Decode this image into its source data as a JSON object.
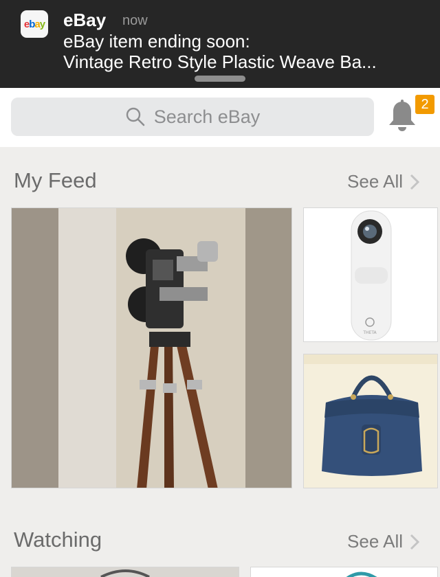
{
  "notification": {
    "app_name": "eBay",
    "time": "now",
    "line1": "eBay item ending soon:",
    "line2": "Vintage Retro Style Plastic Weave Ba...",
    "logo_letters": [
      "e",
      "b",
      "a",
      "y"
    ]
  },
  "search": {
    "placeholder": "Search eBay"
  },
  "notifications_badge": "2",
  "feed": {
    "title": "My Feed",
    "see_all": "See All"
  },
  "feed_items": [
    {
      "icon": "vintage-movie-camera-tripod-image"
    },
    {
      "icon": "theta-360-camera-image",
      "brand_text": "THETA"
    },
    {
      "icon": "blue-leather-handbag-image"
    }
  ],
  "watching": {
    "title": "Watching",
    "see_all": "See All"
  },
  "colors": {
    "badge": "#f29a00",
    "banner": "#262626",
    "page_bg": "#efeeec"
  }
}
